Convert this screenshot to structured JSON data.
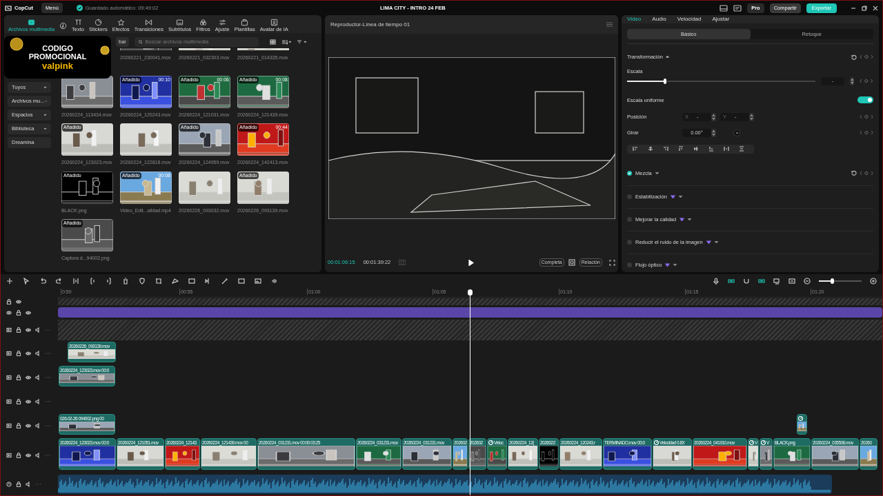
{
  "app": {
    "logo": "CopCut",
    "menu": "Menú",
    "autosave": "Guardado automático: 09:49:02",
    "title": "LIMA CITY - INTRO 24 FEB",
    "pro": "Pro",
    "share": "Compartir",
    "export": "Exportar"
  },
  "tool_tabs": [
    {
      "kind": "media",
      "label": "Archivos multimedia",
      "selected": true
    },
    {
      "kind": "audio",
      "selected": false
    },
    {
      "kind": "text",
      "label": "Texto",
      "selected": false
    },
    {
      "kind": "stickers",
      "label": "Stickers",
      "selected": false
    },
    {
      "kind": "effects",
      "label": "Efectos",
      "selected": false
    },
    {
      "kind": "transitions",
      "label": "Transiciones",
      "selected": false
    },
    {
      "kind": "captions",
      "label": "Subtítulos",
      "selected": false
    },
    {
      "kind": "filters",
      "label": "Filtros",
      "selected": false
    },
    {
      "kind": "adjust",
      "label": "Ajuste",
      "selected": false
    },
    {
      "kind": "templates",
      "label": "Plantillas",
      "selected": false
    },
    {
      "kind": "avatar",
      "label": "Avatar de IA",
      "selected": false
    }
  ],
  "promo": {
    "line_1": "CODIGO",
    "line_2": "PROMOCIONAL",
    "line_3": "valpink"
  },
  "media": {
    "record_button": "bar",
    "search": {
      "placeholder": "Buscar archivos multimedia"
    },
    "sidebar": [
      {
        "label": "Tuyos",
        "expandable": true
      },
      {
        "label": "Archivos mu...",
        "expandable": true
      },
      {
        "label": "Espacios",
        "expandable": true
      },
      {
        "label": "Biblioteca",
        "expandable": true
      },
      {
        "label": "Dreamina",
        "expandable": false
      }
    ],
    "top_row_names": [
      "20260221_230041.mov",
      "20260221_032303.mov",
      "20260221_014335.mov"
    ],
    "items": [
      {
        "name": "20260224_113434.mov"
      },
      {
        "name": "20260224_120243.mov",
        "badge": "Añadido",
        "duration": "00:10"
      },
      {
        "name": "20260224_121031.mov",
        "badge": "Añadido",
        "duration": "00:06"
      },
      {
        "name": "20260224_121439.mov",
        "badge": "Añadido",
        "duration": "00:08"
      },
      {
        "name": "20260224_123023.mov",
        "badge": "Añadido"
      },
      {
        "name": "20260224_122818.mov"
      },
      {
        "name": "20260224_124959.mov",
        "badge": "Añadido"
      },
      {
        "name": "20260224_142413.mov",
        "badge": "Añadido",
        "duration": "00:44"
      },
      {
        "name": "BLACK.png",
        "badge": "Añadido"
      },
      {
        "name": "Video_Edit...alidad.mp4",
        "badge": "Añadido",
        "duration": "00:08"
      },
      {
        "name": "20260226_093032.mov"
      },
      {
        "name": "20260226_093139.mov",
        "badge": "Añadido"
      },
      {
        "name": "Captura d...94002.png",
        "badge": "Añadido"
      }
    ]
  },
  "player": {
    "title": "Reproductor-Línea de tiempo 01",
    "current_time": "00:01:06:15",
    "total_time": "00:01:39:22",
    "fit_button": "Completa",
    "ratio_button": "Relación"
  },
  "properties": {
    "tabs": [
      {
        "label": "Video",
        "selected": true
      },
      {
        "label": "Audio",
        "selected": false
      },
      {
        "label": "Velocidad",
        "selected": false
      },
      {
        "label": "Ajustar",
        "selected": false
      }
    ],
    "subtabs": [
      {
        "label": "Básico",
        "selected": true
      },
      {
        "label": "Retoque",
        "selected": false
      }
    ],
    "section": "Transformación",
    "scale": {
      "label": "Escala",
      "level": 0.2,
      "value": "-"
    },
    "uniform_scale": {
      "label": "Escala uniforme",
      "on": true
    },
    "position": {
      "label": "Posición",
      "x_label": "X",
      "x": "-",
      "y_label": "Y",
      "y": "-"
    },
    "rotate": {
      "label": "Girar",
      "value": "0.00°"
    },
    "options": [
      {
        "label": "Mezcla",
        "checked": true,
        "pro": false
      },
      {
        "label": "Estabilización",
        "checked": false,
        "pro": true
      },
      {
        "label": "Mejorar la calidad",
        "checked": false,
        "pro": true
      },
      {
        "label": "Reducir el ruido de la imagen",
        "checked": false,
        "pro": true
      },
      {
        "label": "Flujo óptico",
        "checked": false,
        "pro": true
      }
    ]
  },
  "timeline": {
    "zoom": {
      "level": 0.3
    },
    "ruler": [
      "0:50",
      "00:55",
      "01:00",
      "01:05",
      "01:10",
      "01:15",
      "01:20"
    ],
    "tracks": [
      {
        "kind": "hatch"
      },
      {
        "kind": "text"
      },
      {
        "kind": "hatch_tall"
      },
      {
        "kind": "overlay",
        "clips": [
          {
            "label": "20260226_093139.mov"
          }
        ]
      },
      {
        "kind": "overlay",
        "clips": [
          {
            "label": "20260224_123023.mov  00:0"
          }
        ]
      },
      {
        "kind": "overlay"
      },
      {
        "kind": "overlay",
        "clips": [
          {
            "label": "026-02-26 094002.png  00"
          },
          {
            "speed": true
          }
        ]
      },
      {
        "kind": "main",
        "clips": [
          {
            "label": "20260224_123023.mov  00:0"
          },
          {
            "label": "20260224_121051.mov"
          },
          {
            "label": "20260224_12143"
          },
          {
            "label": "20260224_121439.mov  00"
          },
          {
            "label": "20260224_031231.mov  00:00:03:25"
          },
          {
            "label": "20260224_031231.mov"
          },
          {
            "label": "20260224_031231.mov"
          },
          {
            "label": "202602"
          },
          {
            "label": "202602"
          },
          {
            "label": "Veloc",
            "speed": true
          },
          {
            "label": "20260224_12("
          },
          {
            "label": "2026022"
          },
          {
            "label": "20260224_120243.r"
          },
          {
            "label": "TERMINADO.mov  00:0"
          },
          {
            "label": "Velocidad 0.8X",
            "speed": true
          },
          {
            "label": "20260224_041910.mov"
          },
          {
            "label": "V",
            "speed": true
          },
          {
            "label": "V",
            "speed": true
          },
          {
            "label": "BLACK.png"
          },
          {
            "label": "20260224_035508.mov"
          },
          {
            "label": "20260"
          }
        ]
      },
      {
        "kind": "audio"
      }
    ]
  }
}
